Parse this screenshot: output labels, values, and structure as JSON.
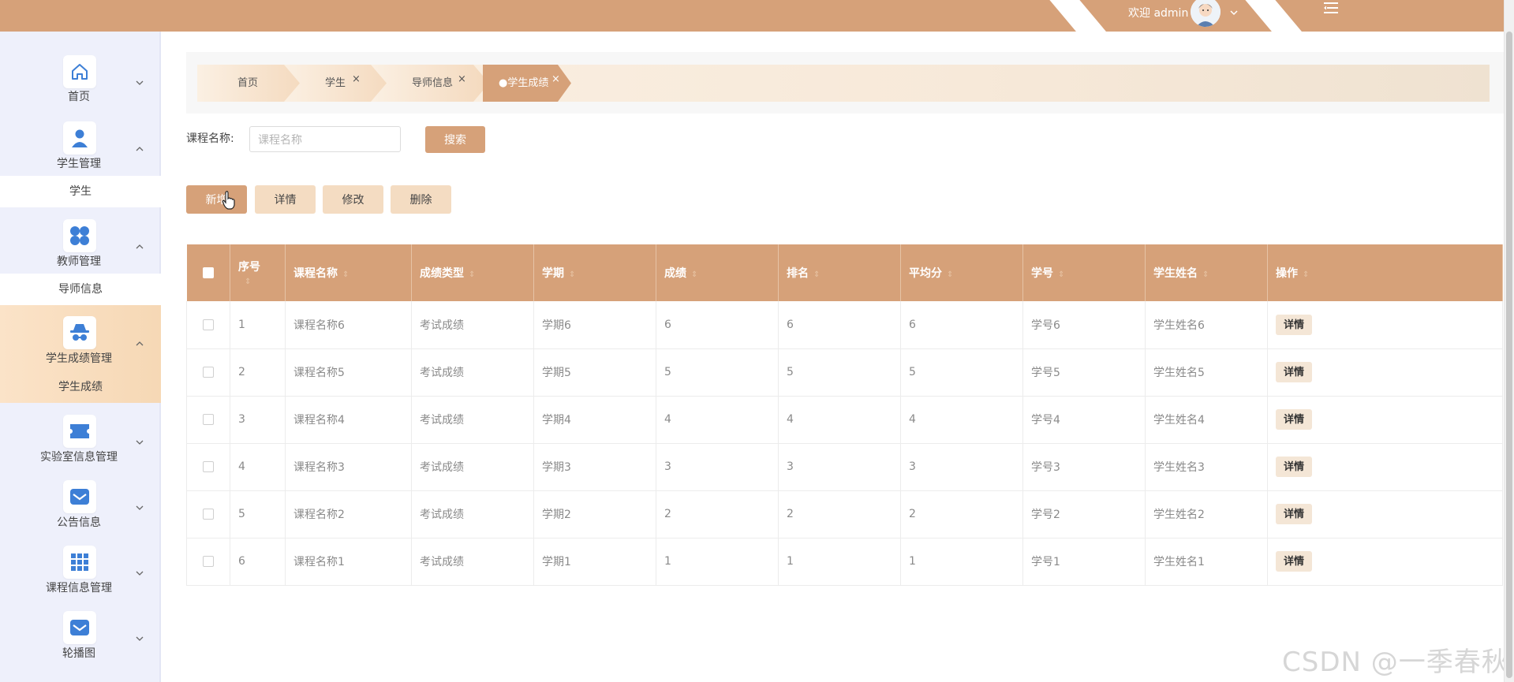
{
  "header": {
    "welcome_text": "欢迎 admin",
    "avatar_icon": "user-avatar",
    "menu_toggle_icon": "hamburger-icon",
    "accent_color": "#d6a179"
  },
  "sidebar": {
    "items": [
      {
        "label": "首页",
        "icon": "home-icon",
        "expanded": false
      },
      {
        "label": "学生管理",
        "icon": "user-icon",
        "expanded": true,
        "sub": "学生"
      },
      {
        "label": "教师管理",
        "icon": "grid-circles-icon",
        "expanded": true,
        "sub": "导师信息"
      },
      {
        "label": "学生成绩管理",
        "icon": "detective-icon",
        "expanded": true,
        "sub": "学生成绩",
        "active": true
      },
      {
        "label": "实验室信息管理",
        "icon": "ticket-icon",
        "expanded": false
      },
      {
        "label": "公告信息",
        "icon": "mail-icon",
        "expanded": false
      },
      {
        "label": "课程信息管理",
        "icon": "apps-icon",
        "expanded": false
      },
      {
        "label": "轮播图",
        "icon": "mail-icon",
        "expanded": false
      }
    ]
  },
  "tabs": [
    {
      "label": "首页",
      "closable": false
    },
    {
      "label": "学生",
      "closable": true
    },
    {
      "label": "导师信息",
      "closable": true
    },
    {
      "label": "●学生成绩",
      "closable": true,
      "active": true
    }
  ],
  "search": {
    "label": "课程名称:",
    "placeholder": "课程名称",
    "value": "",
    "button": "搜索"
  },
  "actions": {
    "add": "新增",
    "detail": "详情",
    "edit": "修改",
    "delete": "删除"
  },
  "table": {
    "headers": [
      "序号",
      "课程名称",
      "成绩类型",
      "学期",
      "成绩",
      "排名",
      "平均分",
      "学号",
      "学生姓名",
      "操作"
    ],
    "rows": [
      [
        "1",
        "课程名称6",
        "考试成绩",
        "学期6",
        "6",
        "6",
        "6",
        "学号6",
        "学生姓名6"
      ],
      [
        "2",
        "课程名称5",
        "考试成绩",
        "学期5",
        "5",
        "5",
        "5",
        "学号5",
        "学生姓名5"
      ],
      [
        "3",
        "课程名称4",
        "考试成绩",
        "学期4",
        "4",
        "4",
        "4",
        "学号4",
        "学生姓名4"
      ],
      [
        "4",
        "课程名称3",
        "考试成绩",
        "学期3",
        "3",
        "3",
        "3",
        "学号3",
        "学生姓名3"
      ],
      [
        "5",
        "课程名称2",
        "考试成绩",
        "学期2",
        "2",
        "2",
        "2",
        "学号2",
        "学生姓名2"
      ],
      [
        "6",
        "课程名称1",
        "考试成绩",
        "学期1",
        "1",
        "1",
        "1",
        "学号1",
        "学生姓名1"
      ]
    ],
    "row_action": "详情"
  },
  "watermark": "CSDN @一季春秋"
}
